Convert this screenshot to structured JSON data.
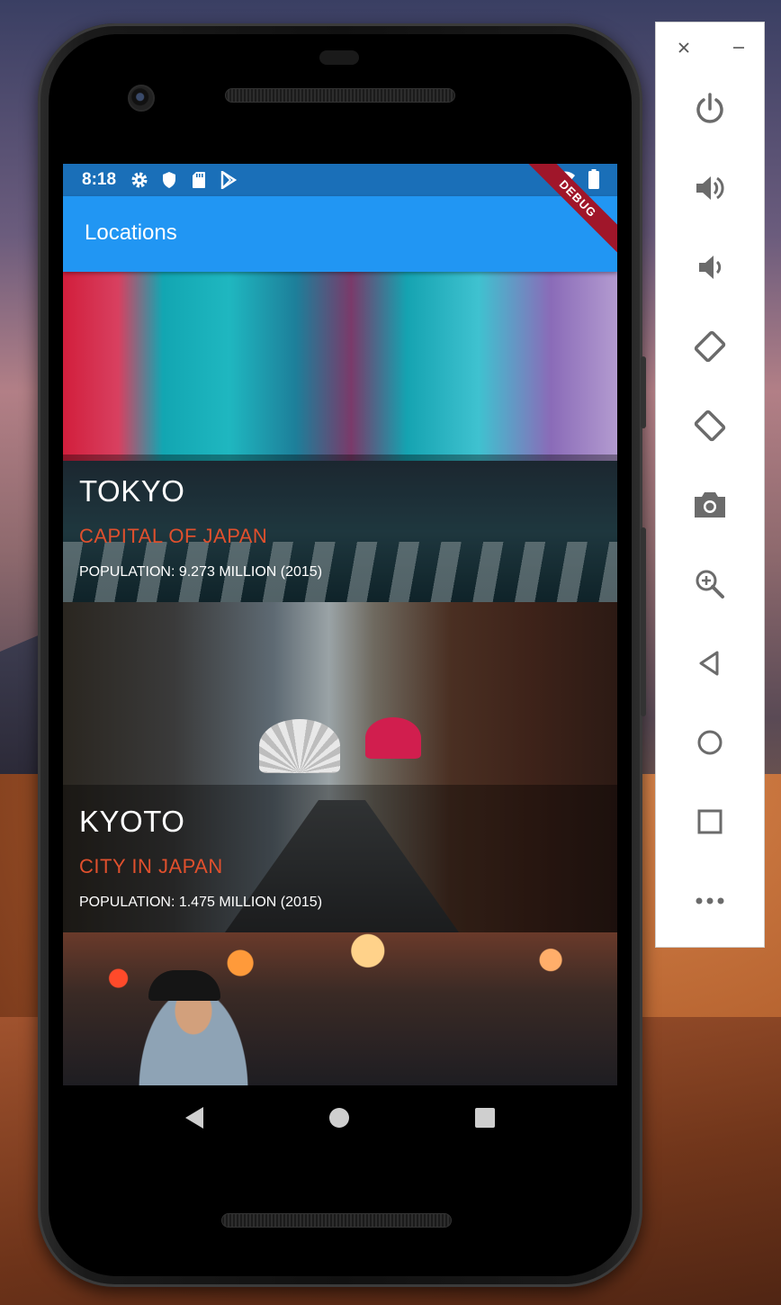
{
  "status": {
    "time": "8:18",
    "left_icons": [
      "settings-icon",
      "shield-icon",
      "sd-card-icon",
      "play-store-icon"
    ],
    "right_icons": [
      "wifi-icon",
      "battery-icon"
    ]
  },
  "appbar": {
    "title": "Locations",
    "debug_label": "DEBUG",
    "color": "#2196f3"
  },
  "locations": [
    {
      "city": "TOKYO",
      "subtitle": "CAPITAL OF JAPAN",
      "population": "POPULATION: 9.273 MILLION (2015)"
    },
    {
      "city": "KYOTO",
      "subtitle": "CITY IN JAPAN",
      "population": "POPULATION: 1.475 MILLION (2015)"
    }
  ],
  "colors": {
    "subtitle": "#e0502d",
    "statusbar": "#1a6fb8"
  },
  "emulator_panel": {
    "window_controls": [
      "close-icon",
      "minimize-icon"
    ],
    "buttons": [
      "power-icon",
      "volume-up-icon",
      "volume-down-icon",
      "rotate-left-icon",
      "rotate-right-icon",
      "camera-icon",
      "zoom-icon",
      "back-icon",
      "home-icon",
      "overview-icon",
      "more-icon"
    ]
  }
}
